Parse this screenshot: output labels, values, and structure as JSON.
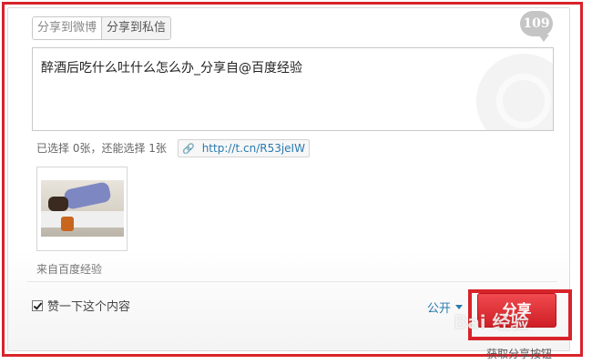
{
  "tabs": [
    {
      "label": "分享到微博",
      "active": true
    },
    {
      "label": "分享到私信",
      "active": false
    }
  ],
  "counter": "109",
  "message": {
    "text": "醉酒后吃什么吐什么怎么办_分享自@百度经验"
  },
  "image_selection": {
    "text": "已选择 0张，还能选择 1张"
  },
  "short_link": {
    "url": "http://t.cn/R53jeIW"
  },
  "source": {
    "text": "来自百度经验"
  },
  "like": {
    "label": "赞一下这个内容",
    "checked": true
  },
  "visibility": {
    "label": "公开"
  },
  "share_button": {
    "label": "分享"
  },
  "get_share_button": {
    "label": "获取分享按钮"
  },
  "watermark": {
    "text": "Bai 经验"
  },
  "colors": {
    "accent_red": "#d8232a",
    "link_blue": "#2a7ab0"
  }
}
